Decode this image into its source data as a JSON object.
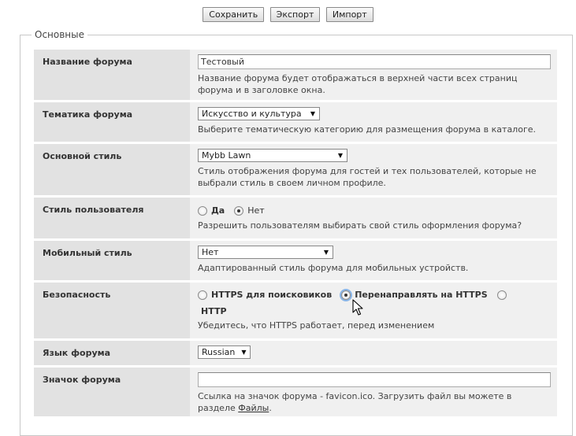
{
  "toolbar": {
    "save_label": "Сохранить",
    "export_label": "Экспорт",
    "import_label": "Импорт"
  },
  "section": {
    "title": "Основные"
  },
  "settings": {
    "forum_name": {
      "label": "Название форума",
      "value": "Тестовый",
      "desc": "Название форума будет отображаться в верхней части всех страниц форума и в заголовке окна."
    },
    "topic": {
      "label": "Тематика форума",
      "value": "Искусство и культура",
      "desc": "Выберите тематическую категорию для размещения форума в каталоге."
    },
    "main_style": {
      "label": "Основной стиль",
      "value": "Mybb Lawn",
      "desc": "Стиль отображения форума для гостей и тех пользователей, которые не выбрали стиль в своем личном профиле."
    },
    "user_style": {
      "label": "Стиль пользователя",
      "option_yes": "Да",
      "option_no": "Нет",
      "selected": "Нет",
      "desc": "Разрешить пользователям выбирать свой стиль оформления форума?"
    },
    "mobile_style": {
      "label": "Мобильный стиль",
      "value": "Нет",
      "desc": "Адаптированный стиль форума для мобильных устройств."
    },
    "security": {
      "label": "Безопасность",
      "option_1": "HTTPS для поисковиков",
      "option_2": "Перенаправлять на HTTPS",
      "option_3": "HTTP",
      "selected": "Перенаправлять на HTTPS",
      "desc": "Убедитесь, что HTTPS работает, перед изменением"
    },
    "language": {
      "label": "Язык форума",
      "value": "Russian"
    },
    "favicon": {
      "label": "Значок форума",
      "value": "",
      "desc_prefix": "Ссылка на значок форума - favicon.ico. Загрузить файл вы можете в разделе ",
      "desc_link": "Файлы",
      "desc_suffix": "."
    }
  },
  "icons": {
    "caret": "caret-down-icon",
    "pointer": "mouse-pointer-icon"
  }
}
